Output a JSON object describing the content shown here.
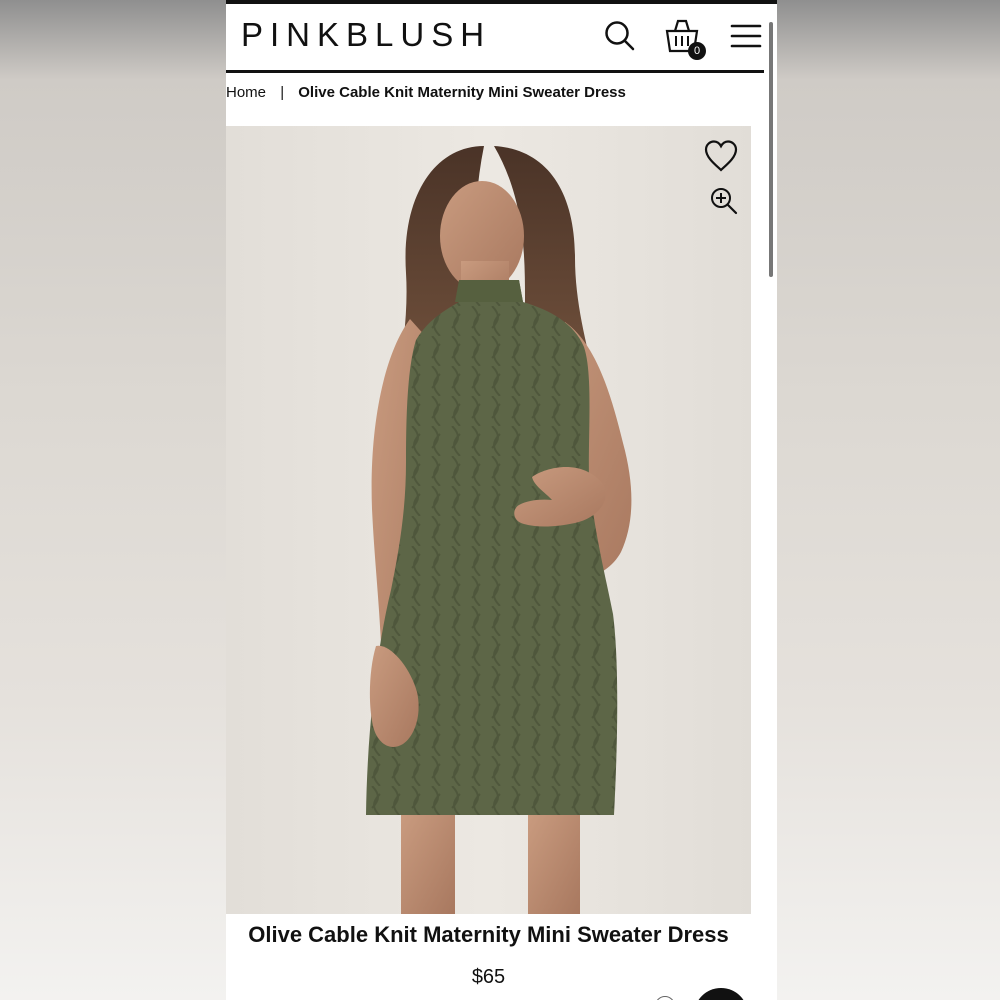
{
  "brand": "PINKBLUSH",
  "header": {
    "search_icon": "search-icon",
    "cart_icon": "cart-icon",
    "cart_count": "0",
    "menu_icon": "menu-icon"
  },
  "breadcrumb": {
    "home": "Home",
    "separator": "|",
    "current": "Olive Cable Knit Maternity Mini Sweater Dress"
  },
  "product": {
    "title": "Olive Cable Knit Maternity Mini Sweater Dress",
    "price": "$65",
    "wishlist_icon": "heart-icon",
    "zoom_icon": "zoom-in-icon"
  },
  "colors": {
    "accent": "#111111",
    "dress": "#5d6647",
    "background": "#e4e0db"
  }
}
